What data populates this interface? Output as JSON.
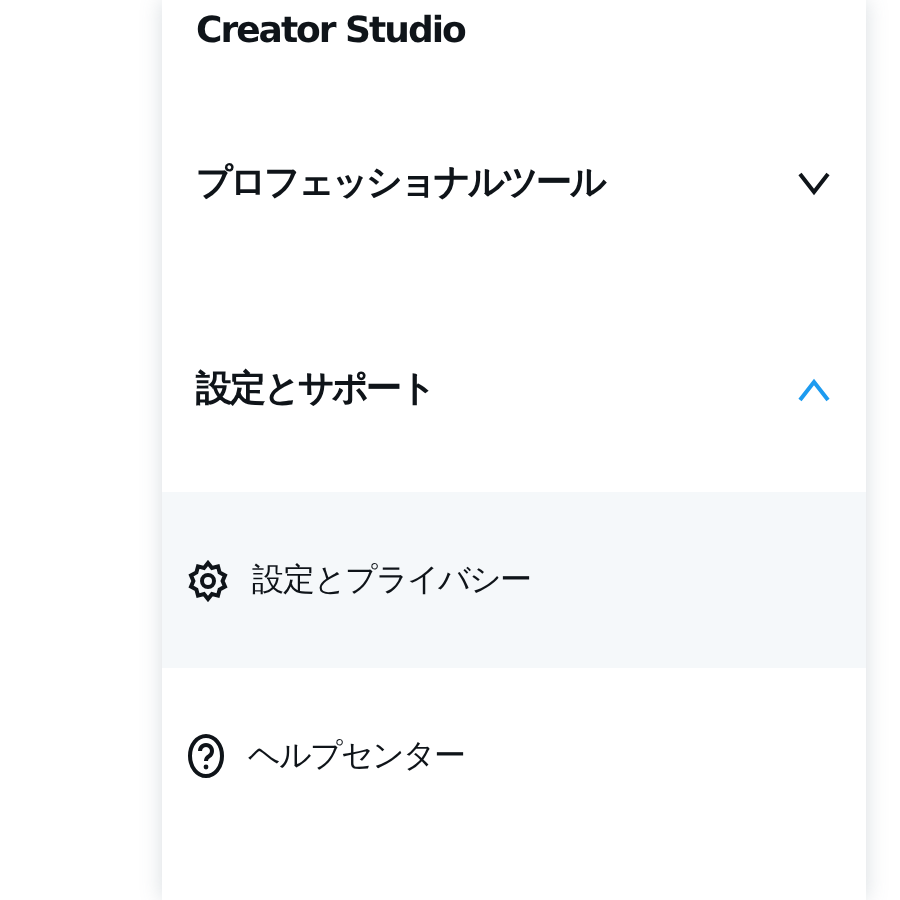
{
  "menu": {
    "items": [
      {
        "kind": "link",
        "label": "Creator Studio"
      },
      {
        "kind": "section",
        "label": "プロフェッショナルツール",
        "expanded": false
      },
      {
        "kind": "section",
        "label": "設定とサポート",
        "expanded": true,
        "children": [
          {
            "kind": "settings",
            "label": "設定とプライバシー",
            "selected": true
          },
          {
            "kind": "help",
            "label": "ヘルプセンター",
            "selected": false
          }
        ]
      }
    ]
  }
}
